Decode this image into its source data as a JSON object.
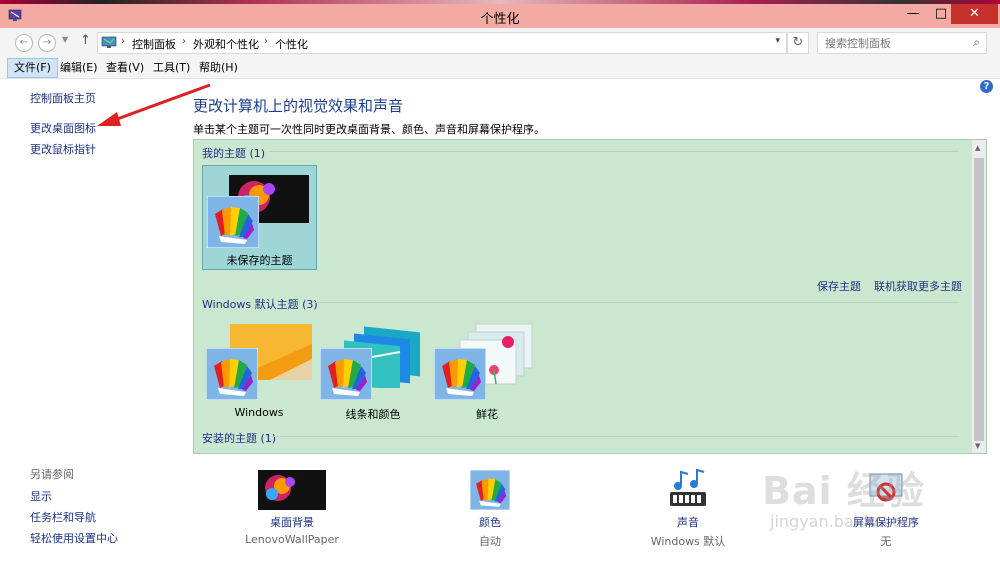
{
  "window": {
    "title": "个性化",
    "controls": {
      "minimize": "—",
      "maximize": "□",
      "close": "✕"
    }
  },
  "address_bar": {
    "breadcrumbs": [
      "控制面板",
      "外观和个性化",
      "个性化"
    ],
    "search_placeholder": "搜索控制面板"
  },
  "menu": [
    "文件(F)",
    "编辑(E)",
    "查看(V)",
    "工具(T)",
    "帮助(H)"
  ],
  "left_pane": {
    "links": [
      "控制面板主页",
      "更改桌面图标",
      "更改鼠标指针"
    ],
    "see_also_title": "另请参阅",
    "see_also": [
      "显示",
      "任务栏和导航",
      "轻松使用设置中心"
    ]
  },
  "main": {
    "heading": "更改计算机上的视觉效果和声音",
    "subheading": "单击某个主题可一次性同时更改桌面背景、颜色、声音和屏幕保护程序。"
  },
  "themes": {
    "my_themes_header": "我的主题 (1)",
    "my_themes": [
      {
        "label": "未保存的主题",
        "selected": true
      }
    ],
    "save_theme_link": "保存主题",
    "get_more_link": "联机获取更多主题",
    "default_header": "Windows 默认主题 (3)",
    "defaults": [
      {
        "label": "Windows"
      },
      {
        "label": "线条和颜色"
      },
      {
        "label": "鲜花"
      }
    ],
    "installed_header": "安装的主题 (1)"
  },
  "bottom_items": [
    {
      "label": "桌面背景",
      "value": "LenovoWallPaper"
    },
    {
      "label": "颜色",
      "value": "自动"
    },
    {
      "label": "声音",
      "value": "Windows 默认"
    },
    {
      "label": "屏幕保护程序",
      "value": "无"
    }
  ],
  "watermark": {
    "main": "Bai 经验",
    "sub": "jingyan.baidu.com"
  },
  "colors": {
    "accent_link": "#1e3287",
    "panel_bg": "#cae8cf",
    "titlebar": "#f3aaa3",
    "close": "#c7312b",
    "arrow": "#e02020"
  }
}
